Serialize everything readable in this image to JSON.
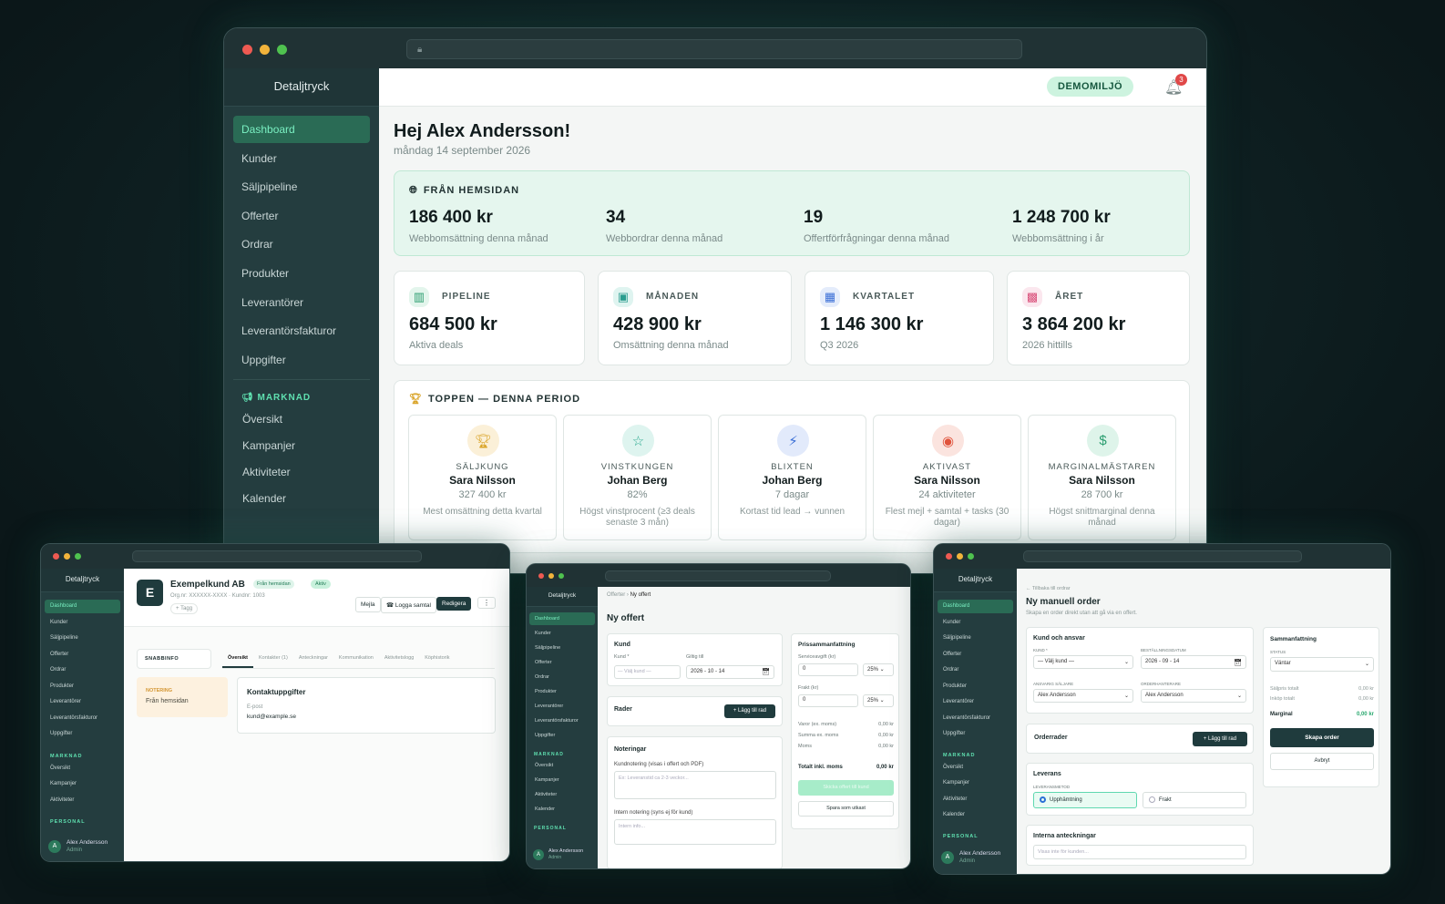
{
  "main_window": {
    "brand": "Detaljtryck",
    "sidebar": [
      "Dashboard",
      "Kunder",
      "Säljpipeline",
      "Offerter",
      "Ordrar",
      "Produkter",
      "Leverantörer",
      "Leverantörsfakturor",
      "Uppgifter"
    ],
    "market_section": "MARKNAD",
    "market_items": [
      "Översikt",
      "Kampanjer",
      "Aktiviteter",
      "Kalender"
    ],
    "env_badge": "DEMOMILJÖ",
    "notif_count": "3",
    "greeting": "Hej Alex Andersson!",
    "date": "måndag 14 september 2026",
    "web": {
      "title": "FRÅN HEMSIDAN",
      "stats": [
        {
          "value": "186 400 kr",
          "label": "Webbomsättning denna månad"
        },
        {
          "value": "34",
          "label": "Webbordrar denna månad"
        },
        {
          "value": "19",
          "label": "Offertförfrågningar denna månad"
        },
        {
          "value": "1 248 700 kr",
          "label": "Webbomsättning i år"
        }
      ]
    },
    "kpis": [
      {
        "title": "PIPELINE",
        "value": "684 500 kr",
        "sub": "Aktiva deals",
        "icon": "bar-chart-icon",
        "color": "#2a9d6f",
        "bg": "#e3f5ec"
      },
      {
        "title": "MÅNADEN",
        "value": "428 900 kr",
        "sub": "Omsättning denna månad",
        "icon": "money-icon",
        "color": "#2a9d8f",
        "bg": "#dff4f0"
      },
      {
        "title": "KVARTALET",
        "value": "1 146 300 kr",
        "sub": "Q3 2026",
        "icon": "calendar-icon",
        "color": "#3b6fd6",
        "bg": "#e4ecfb"
      },
      {
        "title": "ÅRET",
        "value": "3 864 200 kr",
        "sub": "2026 hittills",
        "icon": "presentation-icon",
        "color": "#d94f7a",
        "bg": "#fbe7ee"
      }
    ],
    "top": {
      "title": "TOPPEN — DENNA PERIOD",
      "items": [
        {
          "award": "SÄLJKUNG",
          "name": "Sara Nilsson",
          "value": "327 400 kr",
          "desc": "Mest omsättning detta kvartal",
          "icon": "trophy-icon",
          "color": "#d9a326",
          "bg": "#fbf0d8"
        },
        {
          "award": "VINSTKUNGEN",
          "name": "Johan Berg",
          "value": "82%",
          "desc": "Högst vinstprocent (≥3 deals senaste 3 mån)",
          "icon": "star-icon",
          "color": "#2aa98f",
          "bg": "#def4ef"
        },
        {
          "award": "BLIXTEN",
          "name": "Johan Berg",
          "value": "7 dagar",
          "desc": "Kortast tid lead → vunnen",
          "icon": "lightning-icon",
          "color": "#3b6fd6",
          "bg": "#e2eafb"
        },
        {
          "award": "AKTIVAST",
          "name": "Sara Nilsson",
          "value": "24 aktiviteter",
          "desc": "Flest mejl + samtal + tasks (30 dagar)",
          "icon": "flame-icon",
          "color": "#e0533c",
          "bg": "#fbe4df"
        },
        {
          "award": "MARGINALMÄSTAREN",
          "name": "Sara Nilsson",
          "value": "28 700 kr",
          "desc": "Högst snittmarginal denna månad",
          "icon": "dollar-icon",
          "color": "#2a9d6f",
          "bg": "#def4ea"
        }
      ]
    }
  },
  "win_customer": {
    "brand": "Detaljtryck",
    "sidebar": [
      "Dashboard",
      "Kunder",
      "Säljpipeline",
      "Offerter",
      "Ordrar",
      "Produkter",
      "Leverantörer",
      "Leverantörsfakturor",
      "Uppgifter"
    ],
    "market_section": "MARKNAD",
    "market_items": [
      "Översikt",
      "Kampanjer",
      "Aktiviteter"
    ],
    "personal_section": "PERSONAL",
    "user_name": "Alex Andersson",
    "user_role": "Admin",
    "avatar": "A",
    "initial": "E",
    "name": "Exempelkund AB",
    "badge_source": "Från hemsidan",
    "badge_status": "Aktiv",
    "org": "Org.nr: XXXXXX-XXXX · Kundnr: 1003",
    "tag": "+ Tagg",
    "btn_mail": "Mejla",
    "btn_call": "Logga samtal",
    "btn_edit": "Redigera",
    "quick": "SNABBINFO",
    "tabs": [
      "Översikt",
      "Kontakter (1)",
      "Anteckningar",
      "Kommunikation",
      "Aktivitetslogg",
      "Köphistorik"
    ],
    "note_label": "NOTERING",
    "note_text": "Från hemsidan",
    "contact_title": "Kontaktuppgifter",
    "email_label": "E-post",
    "email": "kund@example.se"
  },
  "win_quote": {
    "brand": "Detaljtryck",
    "sidebar": [
      "Dashboard",
      "Kunder",
      "Säljpipeline",
      "Offerter",
      "Ordrar",
      "Produkter",
      "Leverantörer",
      "Leverantörsfakturor",
      "Uppgifter"
    ],
    "market_section": "MARKNAD",
    "market_items": [
      "Översikt",
      "Kampanjer",
      "Aktiviteter",
      "Kalender"
    ],
    "personal_section": "PERSONAL",
    "user_name": "Alex Andersson",
    "user_role": "Admin",
    "avatar": "A",
    "crumb1": "Offerter",
    "crumb2": "Ny offert",
    "title": "Ny offert",
    "kund_section": "Kund",
    "kund_label": "Kund *",
    "kund_placeholder": "— Välj kund —",
    "valid_label": "Giltig till",
    "valid_value": "2026 - 10 - 14",
    "rows_label": "Rader",
    "add_row": "+ Lägg till rad",
    "notes_title": "Noteringar",
    "note1_label": "Kundnotering (visas i offert och PDF)",
    "note1_ph": "Ex: Leveranstid ca 2-3 veckor...",
    "note2_label": "Intern notering (syns ej för kund)",
    "note2_ph": "Intern info...",
    "sum_title": "Prissammanfattning",
    "service_label": "Serviceavgift (kr)",
    "service_val": "0",
    "service_vat": "25%",
    "freight_label": "Frakt (kr)",
    "freight_val": "0",
    "freight_vat": "25%",
    "lines": [
      {
        "l": "Varor (ex. moms)",
        "v": "0,00 kr"
      },
      {
        "l": "Summa ex. moms",
        "v": "0,00 kr"
      },
      {
        "l": "Moms",
        "v": "0,00 kr"
      }
    ],
    "total_label": "Totalt inkl. moms",
    "total_val": "0,00 kr",
    "send_btn": "Skicka offert till kund",
    "draft_btn": "Spara som utkast"
  },
  "win_order": {
    "brand": "Detaljtryck",
    "sidebar": [
      "Dashboard",
      "Kunder",
      "Säljpipeline",
      "Offerter",
      "Ordrar",
      "Produkter",
      "Leverantörer",
      "Leverantörsfakturor",
      "Uppgifter"
    ],
    "market_section": "MARKNAD",
    "market_items": [
      "Översikt",
      "Kampanjer",
      "Aktiviteter",
      "Kalender"
    ],
    "personal_section": "PERSONAL",
    "user_name": "Alex Andersson",
    "user_role": "Admin",
    "avatar": "A",
    "back": "← Tillbaka till ordrar",
    "title": "Ny manuell order",
    "subtitle": "Skapa en order direkt utan att gå via en offert.",
    "sec1": "Kund och ansvar",
    "kund_label": "KUND *",
    "kund_val": "— Välj kund —",
    "date_label": "BESTÄLLNINGSDATUM",
    "date_val": "2026 - 09 - 14",
    "seller_label": "ANSVARIG SÄLJARE",
    "seller_val": "Alex Andersson",
    "handler_label": "ORDERHANTERARE",
    "handler_val": "Alex Andersson",
    "rows_label": "Orderrader",
    "add_row": "+ Lägg till rad",
    "delivery": "Leverans",
    "method_label": "LEVERANSMETOD",
    "opt1": "Upphämtning",
    "opt2": "Frakt",
    "internal": "Interna anteckningar",
    "internal_ph": "Visas inte för kunden...",
    "sum_title": "Sammanfattning",
    "status_label": "STATUS",
    "status_val": "Väntar",
    "sale_label": "Säljpris totalt",
    "sale_val": "0,00 kr",
    "buy_label": "Inköp totalt",
    "buy_val": "0,00 kr",
    "margin_label": "Marginal",
    "margin_val": "0,00 kr",
    "create_btn": "Skapa order",
    "cancel_btn": "Avbryt"
  }
}
